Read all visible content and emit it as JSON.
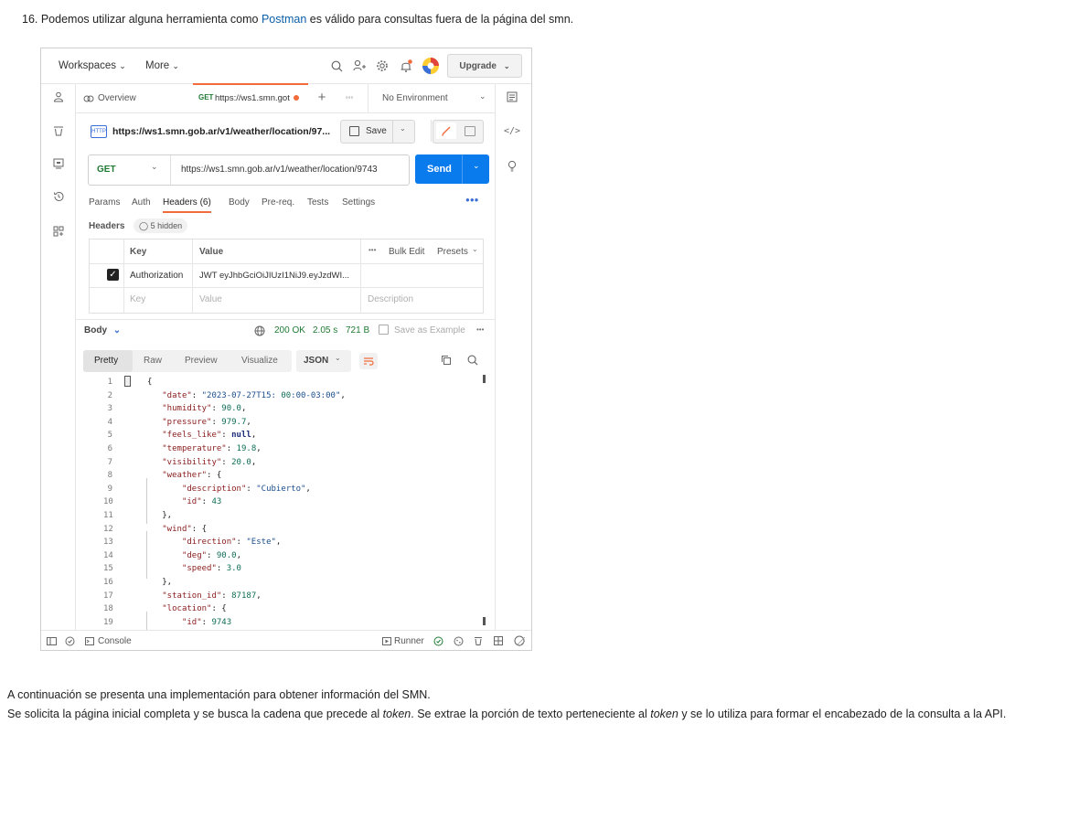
{
  "intro": {
    "before": "16. Podemos utilizar alguna herramienta como ",
    "link": "Postman",
    "after": " es válido para consultas fuera de la página del smn."
  },
  "topbar": {
    "workspaces": "Workspaces",
    "more": "More",
    "upgrade": "Upgrade"
  },
  "tabs": {
    "overview": "Overview",
    "active_method": "GET",
    "active_url": "https://ws1.smn.got",
    "env": "No Environment"
  },
  "request": {
    "title": "https://ws1.smn.gob.ar/v1/weather/location/97...",
    "save": "Save",
    "method": "GET",
    "url": "https://ws1.smn.gob.ar/v1/weather/location/9743",
    "send": "Send"
  },
  "req_tabs": {
    "params": "Params",
    "auth": "Auth",
    "headers": "Headers (6)",
    "body": "Body",
    "prereq": "Pre-req.",
    "tests": "Tests",
    "settings": "Settings"
  },
  "headers_section": {
    "title": "Headers",
    "hidden": "5 hidden",
    "col_key": "Key",
    "col_value": "Value",
    "bulk_edit": "Bulk Edit",
    "presets": "Presets",
    "row_key": "Authorization",
    "row_value": "JWT eyJhbGciOiJIUzI1NiJ9.eyJzdWI...",
    "ph_key": "Key",
    "ph_value": "Value",
    "ph_desc": "Description"
  },
  "response": {
    "body": "Body",
    "status": "200 OK",
    "time": "2.05 s",
    "size": "721 B",
    "save_example": "Save as Example",
    "views": {
      "pretty": "Pretty",
      "raw": "Raw",
      "preview": "Preview",
      "visualize": "Visualize"
    },
    "format": "JSON"
  },
  "code_lines": [
    "{",
    "    \"date\": \"2023-07-27T15:00:00-03:00\",",
    "    \"humidity\": 90.0,",
    "    \"pressure\": 979.7,",
    "    \"feels_like\": null,",
    "    \"temperature\": 19.8,",
    "    \"visibility\": 20.0,",
    "    \"weather\": {",
    "        \"description\": \"Cubierto\",",
    "        \"id\": 43",
    "    },",
    "    \"wind\": {",
    "        \"direction\": \"Este\",",
    "        \"deg\": 90.0,",
    "        \"speed\": 3.0",
    "    },",
    "    \"station_id\": 87187,",
    "    \"location\": {",
    "        \"id\": 9743"
  ],
  "footer": {
    "console": "Console",
    "runner": "Runner"
  },
  "outro": {
    "line1": "A continuación se presenta una implementación para obtener información del SMN.",
    "line2_a": "Se solicita la página inicial completa y se busca la cadena que precede al ",
    "token1": "token",
    "line2_b": ". Se extrae la porción de texto perteneciente al ",
    "token2": "token",
    "line2_c": " y se lo utiliza para formar el encabezado de la consulta a la API."
  }
}
